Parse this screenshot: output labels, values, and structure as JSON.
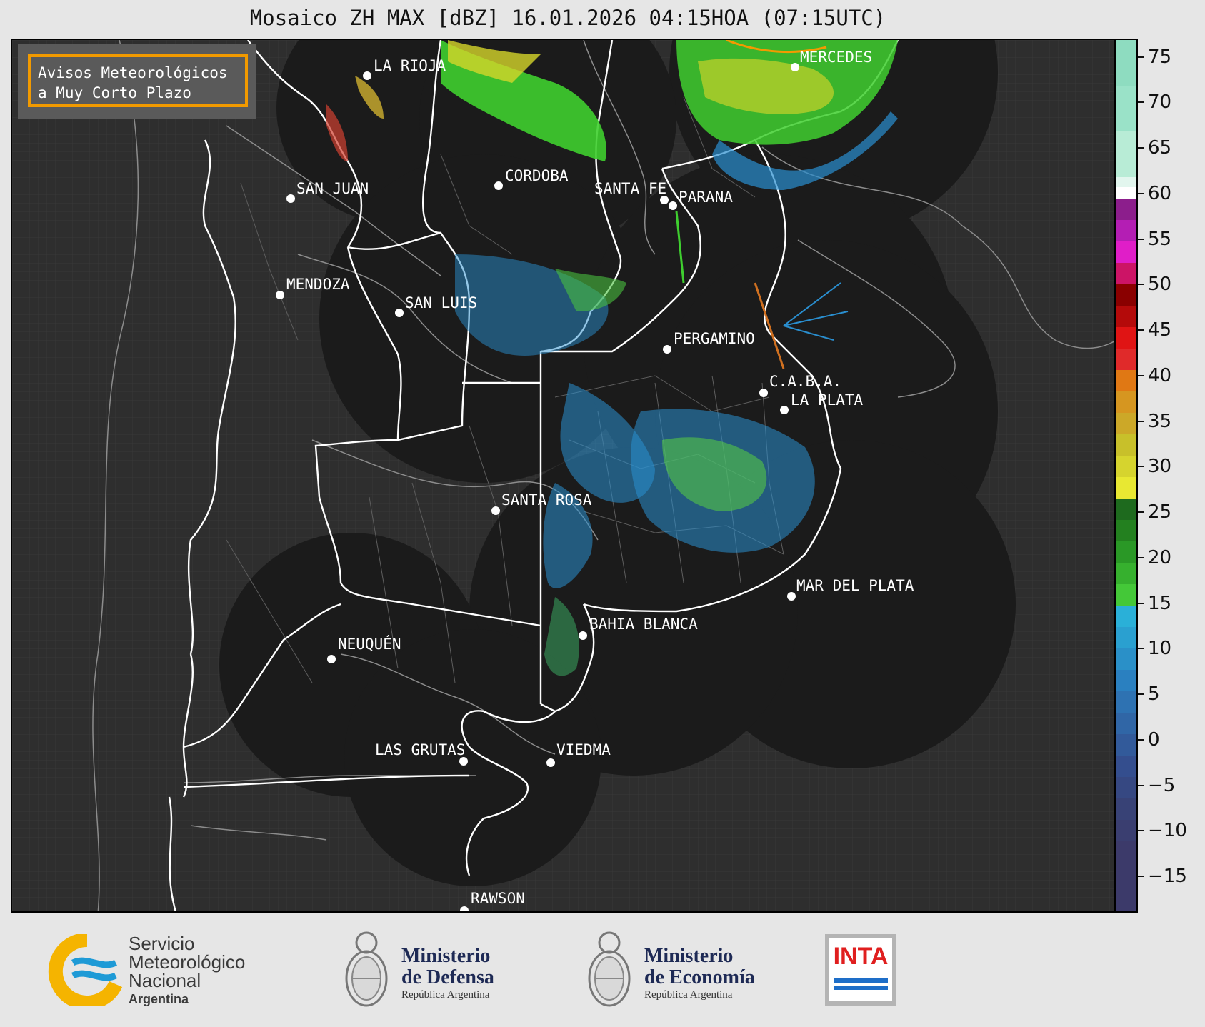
{
  "title": "Mosaico ZH MAX [dBZ] 16.01.2026 04:15HOA (07:15UTC)",
  "notice": {
    "line1": "Avisos Meteorológicos",
    "line2": "a Muy Corto Plazo"
  },
  "cities": [
    {
      "name": "LA RIOJA"
    },
    {
      "name": "MERCEDES"
    },
    {
      "name": "SAN JUAN"
    },
    {
      "name": "CORDOBA"
    },
    {
      "name": "SANTA FE"
    },
    {
      "name": "PARANA"
    },
    {
      "name": "MENDOZA"
    },
    {
      "name": "SAN LUIS"
    },
    {
      "name": "PERGAMINO"
    },
    {
      "name": "C.A.B.A."
    },
    {
      "name": "LA PLATA"
    },
    {
      "name": "SANTA ROSA"
    },
    {
      "name": "MAR DEL PLATA"
    },
    {
      "name": "BAHIA BLANCA"
    },
    {
      "name": "NEUQUÉN"
    },
    {
      "name": "LAS GRUTAS"
    },
    {
      "name": "VIEDMA"
    },
    {
      "name": "RAWSON"
    }
  ],
  "colorbar": {
    "unit": "dBZ",
    "min": -19,
    "max": 77,
    "ticks": [
      "75",
      "70",
      "65",
      "60",
      "55",
      "50",
      "45",
      "40",
      "35",
      "30",
      "25",
      "20",
      "15",
      "10",
      "5",
      "0",
      "−5",
      "−10",
      "−15"
    ]
  },
  "footer": {
    "smn": {
      "line1": "Servicio",
      "line2": "Meteorológico",
      "line3": "Nacional",
      "line4": "Argentina"
    },
    "defensa": {
      "line1": "Ministerio",
      "line2": "de Defensa",
      "line3": "República Argentina"
    },
    "economia": {
      "line1": "Ministerio",
      "line2": "de Economía",
      "line3": "República Argentina"
    },
    "inta": {
      "label": "INTA"
    }
  },
  "colors": {
    "notice_border": "#f29a00",
    "map_bg": "#2e2e2e",
    "radar_disc": "#1b1b1b"
  }
}
